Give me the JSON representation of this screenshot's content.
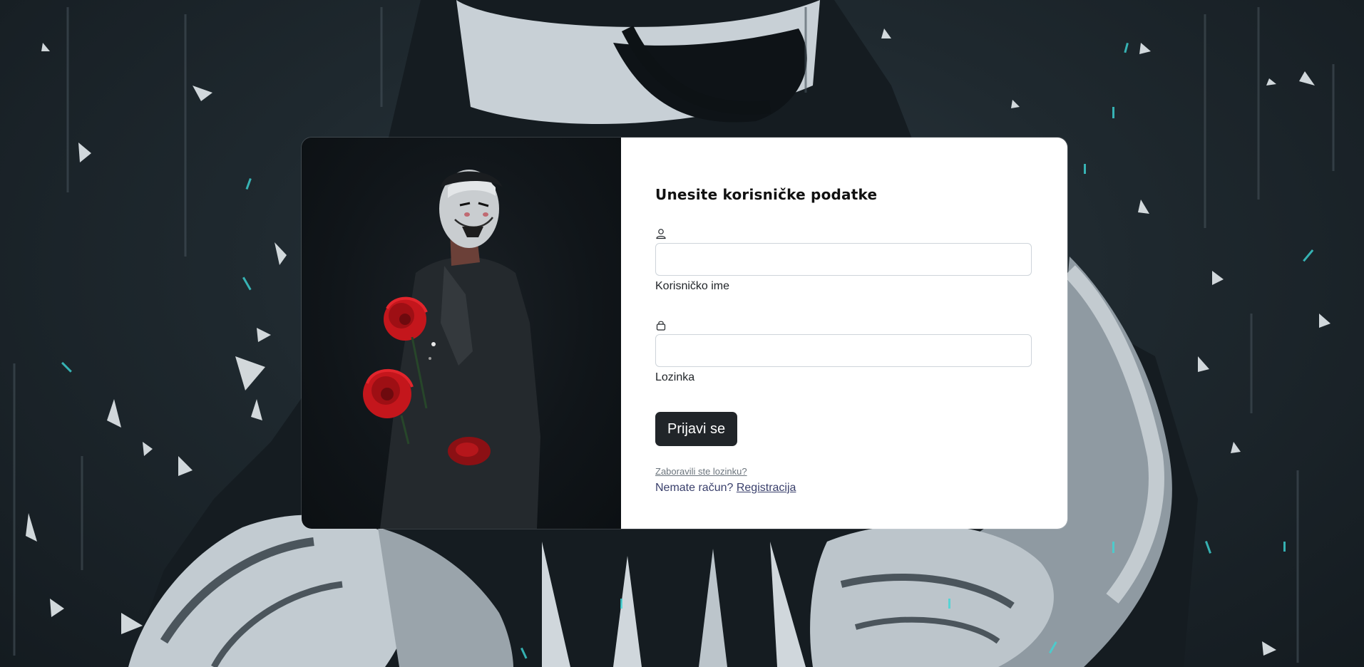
{
  "login": {
    "title": "Unesite korisničke podatke",
    "username": {
      "icon": "person-icon",
      "value": "",
      "placeholder": "",
      "label": "Korisničko ime"
    },
    "password": {
      "icon": "lock-icon",
      "value": "",
      "placeholder": "",
      "label": "Lozinka"
    },
    "submit_label": "Prijavi se",
    "forgot_password": "Zaboravili ste lozinku?",
    "no_account": "Nemate račun?",
    "register_link": "Registracija"
  },
  "colors": {
    "button_bg": "#212529",
    "link_color": "#393f6b",
    "background": "#1f292f",
    "accent_cyan": "#3ed6d6",
    "rose_red": "#c4161c"
  }
}
